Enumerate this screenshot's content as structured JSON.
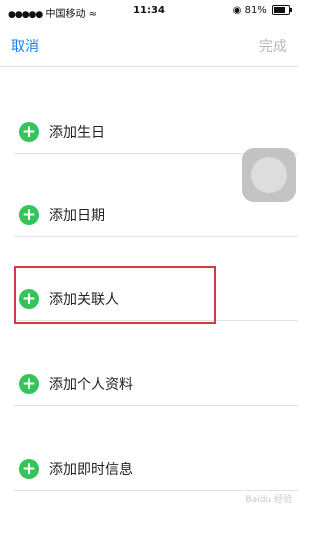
{
  "status_bar": {
    "signal_dots": "●●●●●",
    "carrier": "中国移动",
    "wifi_glyph": "≈",
    "time": "11:34",
    "orientation_lock_glyph": "◉",
    "battery": "81%"
  },
  "navbar": {
    "cancel_label": "取消",
    "done_label": "完成"
  },
  "rows": [
    {
      "label": "添加生日"
    },
    {
      "label": "添加日期"
    },
    {
      "label": "添加关联人"
    },
    {
      "label": "添加个人资料"
    },
    {
      "label": "添加即时信息"
    }
  ],
  "watermark": "Baidu 经验",
  "colors": {
    "accent_blue": "#1a7cf0",
    "plus_green": "#35c45a",
    "highlight_red": "#d23c3c",
    "disabled_gray": "#b8b8b8"
  },
  "icons": {
    "add": "plus-circle-icon",
    "assistive_touch": "assistive-touch-icon"
  }
}
